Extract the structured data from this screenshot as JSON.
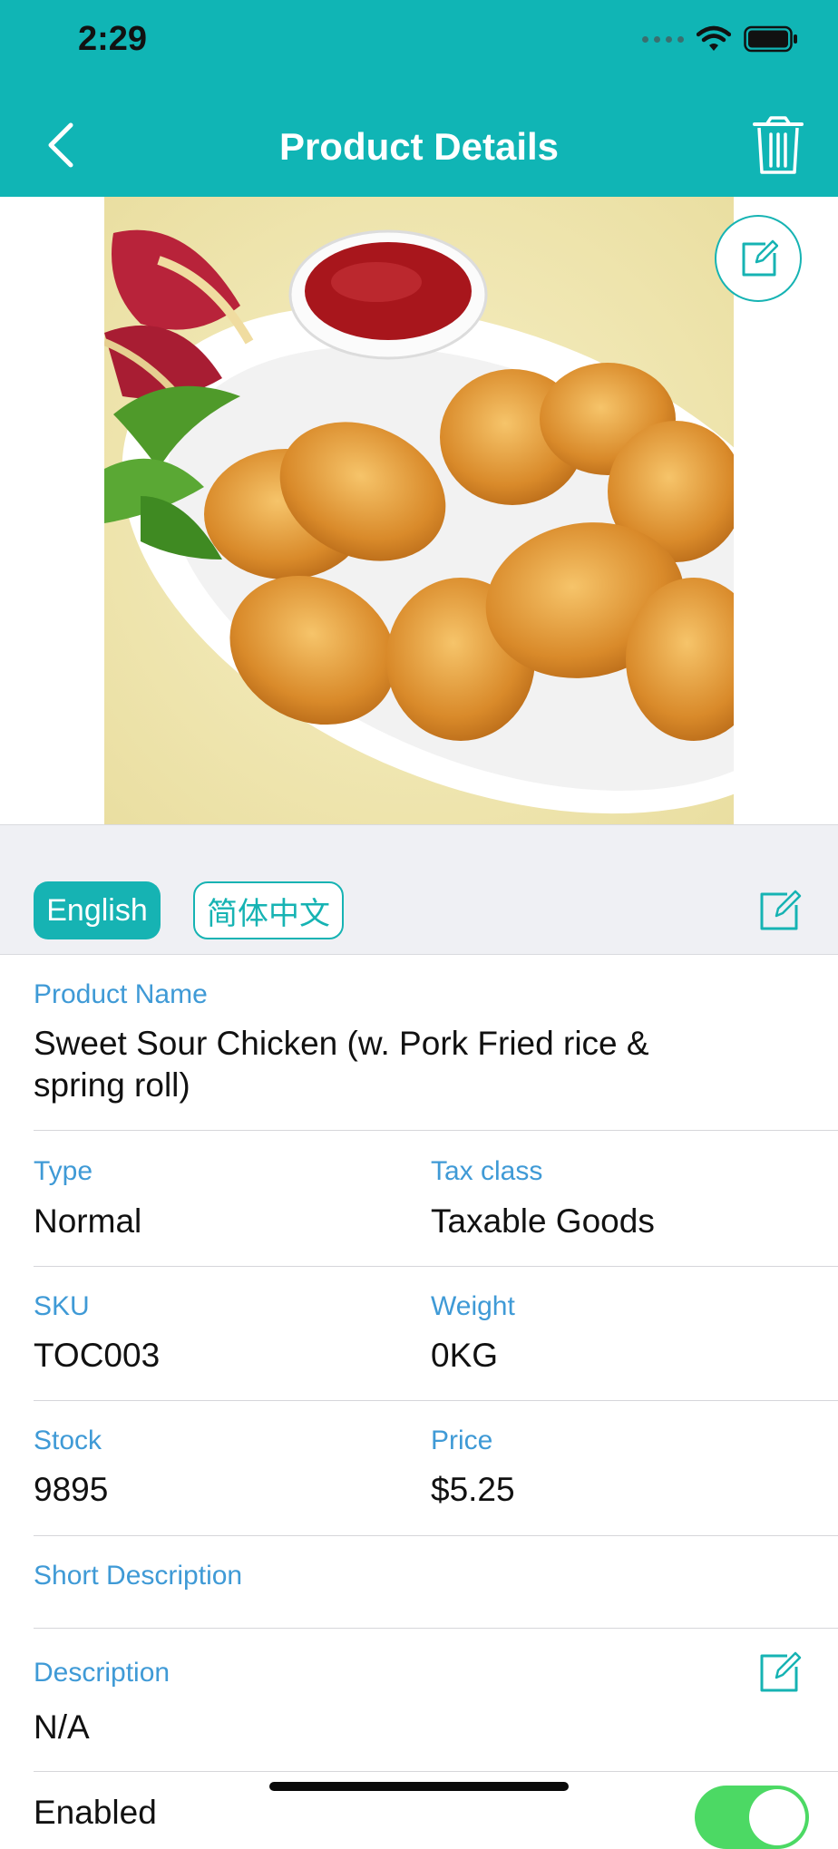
{
  "status_bar": {
    "time": "2:29"
  },
  "header": {
    "title": "Product Details"
  },
  "languages": {
    "active": "English",
    "other": "简体中文"
  },
  "product": {
    "name_label": "Product Name",
    "name_value": "Sweet Sour Chicken (w. Pork Fried rice & spring roll)",
    "type_label": "Type",
    "type_value": "Normal",
    "tax_label": "Tax class",
    "tax_value": "Taxable Goods",
    "sku_label": "SKU",
    "sku_value": "TOC003",
    "weight_label": "Weight",
    "weight_value": "0KG",
    "stock_label": "Stock",
    "stock_value": "9895",
    "price_label": "Price",
    "price_value": "$5.25",
    "short_desc_label": "Short Description",
    "desc_label": "Description",
    "desc_value": "N/A",
    "enabled_label": "Enabled",
    "enabled": true
  },
  "colors": {
    "accent": "#10b5b5",
    "label": "#3f9ad6",
    "toggle_on": "#4cd964"
  },
  "icons": [
    "back-chevron-icon",
    "trash-icon",
    "edit-icon",
    "wifi-icon",
    "battery-icon"
  ]
}
